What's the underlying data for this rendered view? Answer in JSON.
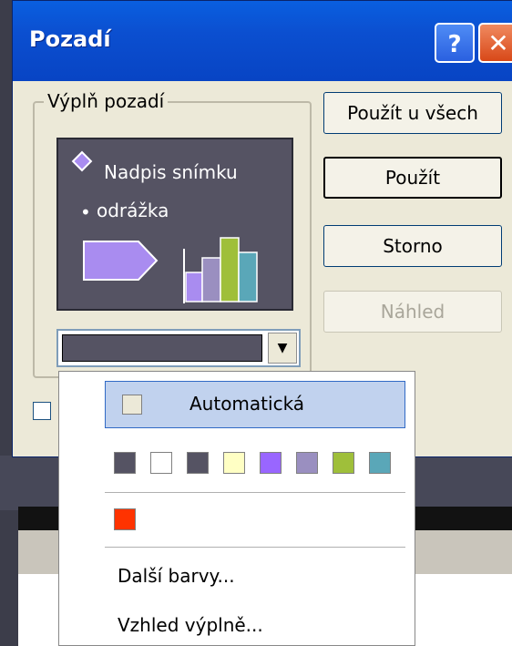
{
  "dialog": {
    "title": "Pozadí",
    "help_glyph": "?",
    "close_glyph": "✕"
  },
  "fill_group": {
    "label": "Výplň pozadí",
    "preview": {
      "title_text": "Nadpis snímku",
      "bullet_glyph": "•",
      "bullet_text": "odrážka",
      "accent_colors": [
        "#a98cf0",
        "#9a8fc0",
        "#9fbf3a",
        "#5aa7b8"
      ]
    },
    "selected_color": "#555363",
    "arrow_glyph": "▼"
  },
  "buttons": {
    "apply_all": "Použít u všech",
    "apply": "Použít",
    "cancel": "Storno",
    "preview": "Náhled"
  },
  "dropdown": {
    "automatic_label": "Automatická",
    "palette": [
      "#555363",
      "#ffffff",
      "#555363",
      "#ffffc4",
      "#9966ff",
      "#9a8fc0",
      "#9fbf3a",
      "#5aa7b8"
    ],
    "recent": [
      "#ff3300"
    ],
    "more_colors": "Další barvy...",
    "fill_effects": "Vzhled výplně..."
  },
  "colors": {
    "titlebar": "#0b4fd0",
    "dialog_bg": "#ece9d8"
  }
}
